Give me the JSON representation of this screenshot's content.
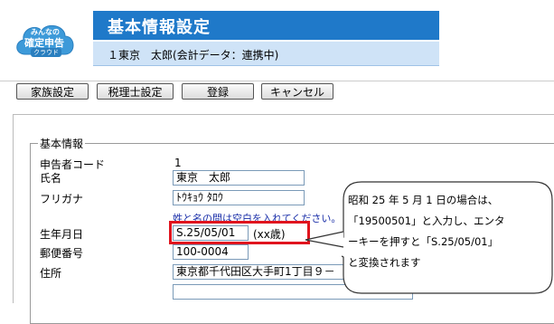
{
  "app": {
    "logo_line1": "みんなの",
    "logo_line2": "確定申告",
    "logo_line3": "クラウド",
    "title": "基本情報設定",
    "user_info": "１東京　太郎(会計データ：連携中)"
  },
  "toolbar": {
    "family": "家族設定",
    "accountant": "税理士設定",
    "register": "登録",
    "cancel": "キャンセル"
  },
  "section": {
    "legend": "基本情報"
  },
  "form": {
    "code_label": "申告者コード",
    "code_value": "1",
    "name_label": "氏名",
    "name_value": "東京　太郎",
    "kana_label": "フリガナ",
    "kana_value": "ﾄｳｷｮｳ ﾀﾛｳ",
    "hint": "姓と名の間は空白を入れてください。",
    "birth_label": "生年月日",
    "birth_value": "S.25/05/01",
    "age_text": "(xx歳)",
    "postal_label": "郵便番号",
    "postal_value": "100-0004",
    "address_label": "住所",
    "address_value": "東京都千代田区大手町1丁目９－",
    "address2_value": ""
  },
  "callout": {
    "line1": "昭和 25 年 5 月 1 日の場合は、",
    "line2": "「19500501」と入力し、エンタ",
    "line3": "ーキーを押すと「S.25/05/01」",
    "line4": "と変換されます"
  },
  "colors": {
    "title_bg": "#1f79c9",
    "user_bar_bg": "#cfe3f7",
    "highlight": "#e0141e",
    "hint": "#1a2ea8"
  }
}
